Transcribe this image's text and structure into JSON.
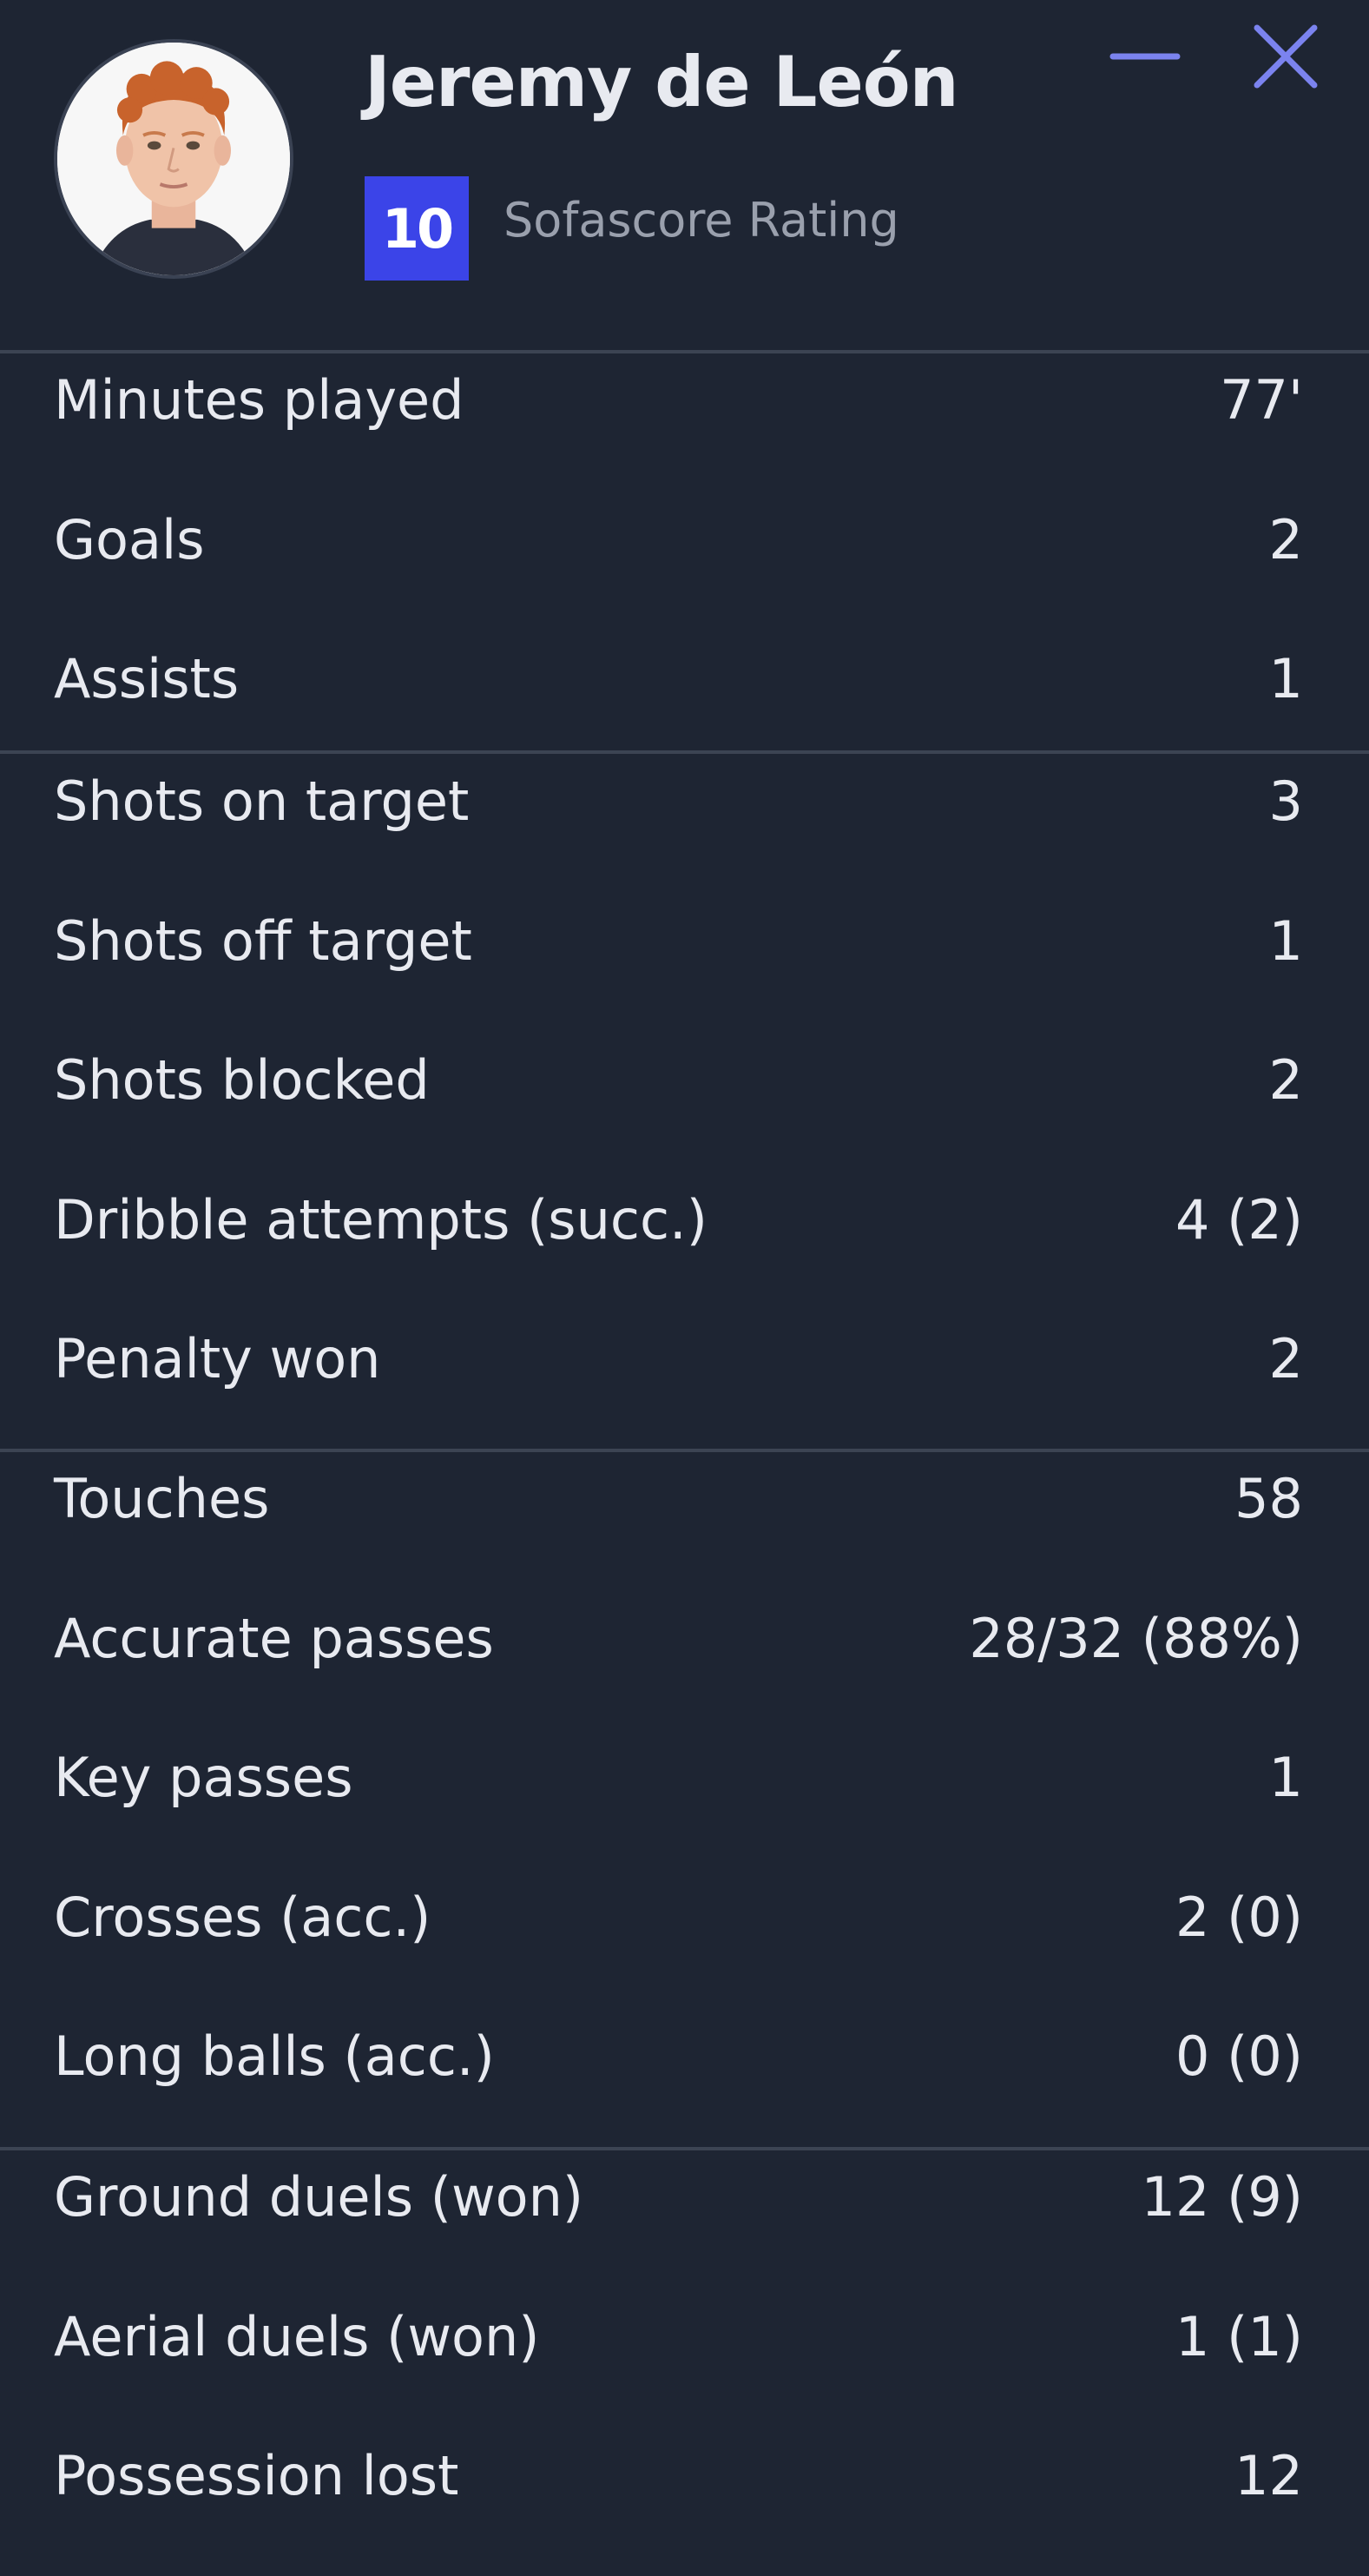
{
  "header": {
    "player_name": "Jeremy de León",
    "rating": "10",
    "rating_label": "Sofascore Rating",
    "rating_color": "#3b44e8",
    "minimize_icon": "minimize-icon",
    "close_icon": "close-icon",
    "accent_color": "#7b83ef"
  },
  "groups": [
    {
      "rows": [
        {
          "label": "Minutes played",
          "value": "77'"
        },
        {
          "label": "Goals",
          "value": "2"
        },
        {
          "label": "Assists",
          "value": "1"
        }
      ]
    },
    {
      "rows": [
        {
          "label": "Shots on target",
          "value": "3"
        },
        {
          "label": "Shots off target",
          "value": "1"
        },
        {
          "label": "Shots blocked",
          "value": "2"
        },
        {
          "label": "Dribble attempts (succ.)",
          "value": "4 (2)"
        },
        {
          "label": "Penalty won",
          "value": "2"
        }
      ]
    },
    {
      "rows": [
        {
          "label": "Touches",
          "value": "58"
        },
        {
          "label": "Accurate passes",
          "value": "28/32 (88%)"
        },
        {
          "label": "Key passes",
          "value": "1"
        },
        {
          "label": "Crosses (acc.)",
          "value": "2 (0)"
        },
        {
          "label": "Long balls (acc.)",
          "value": "0 (0)"
        }
      ]
    },
    {
      "rows": [
        {
          "label": "Ground duels (won)",
          "value": "12 (9)"
        },
        {
          "label": "Aerial duels (won)",
          "value": "1 (1)"
        },
        {
          "label": "Possession lost",
          "value": "12"
        }
      ]
    }
  ]
}
